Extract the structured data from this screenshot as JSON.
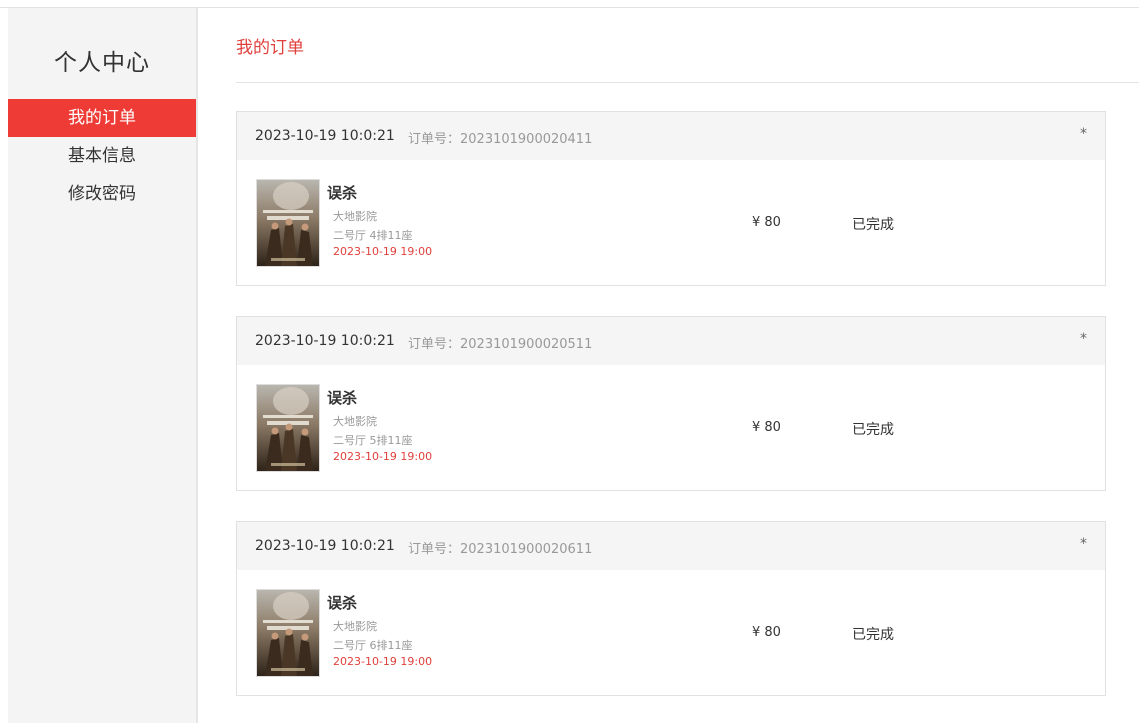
{
  "sidebar": {
    "title": "个人中心",
    "items": [
      {
        "label": "我的订单",
        "active": true
      },
      {
        "label": "基本信息",
        "active": false
      },
      {
        "label": "修改密码",
        "active": false
      }
    ]
  },
  "main": {
    "title": "我的订单"
  },
  "orders": [
    {
      "time": "2023-10-19 10:0:21",
      "order_no": "订单号：2023101900020411",
      "close": "*",
      "movie": "误杀",
      "cinema": "大地影院",
      "seat": "二号厅 4排11座",
      "showtime": "2023-10-19 19:00",
      "price": "¥ 80",
      "status": "已完成"
    },
    {
      "time": "2023-10-19 10:0:21",
      "order_no": "订单号：2023101900020511",
      "close": "*",
      "movie": "误杀",
      "cinema": "大地影院",
      "seat": "二号厅 5排11座",
      "showtime": "2023-10-19 19:00",
      "price": "¥ 80",
      "status": "已完成"
    },
    {
      "time": "2023-10-19 10:0:21",
      "order_no": "订单号：2023101900020611",
      "close": "*",
      "movie": "误杀",
      "cinema": "大地影院",
      "seat": "二号厅 6排11座",
      "showtime": "2023-10-19 19:00",
      "price": "¥ 80",
      "status": "已完成"
    }
  ],
  "colors": {
    "accent": "#ee3b36",
    "sidebar_bg": "#f4f4f4",
    "header_bg": "#f5f5f5"
  }
}
